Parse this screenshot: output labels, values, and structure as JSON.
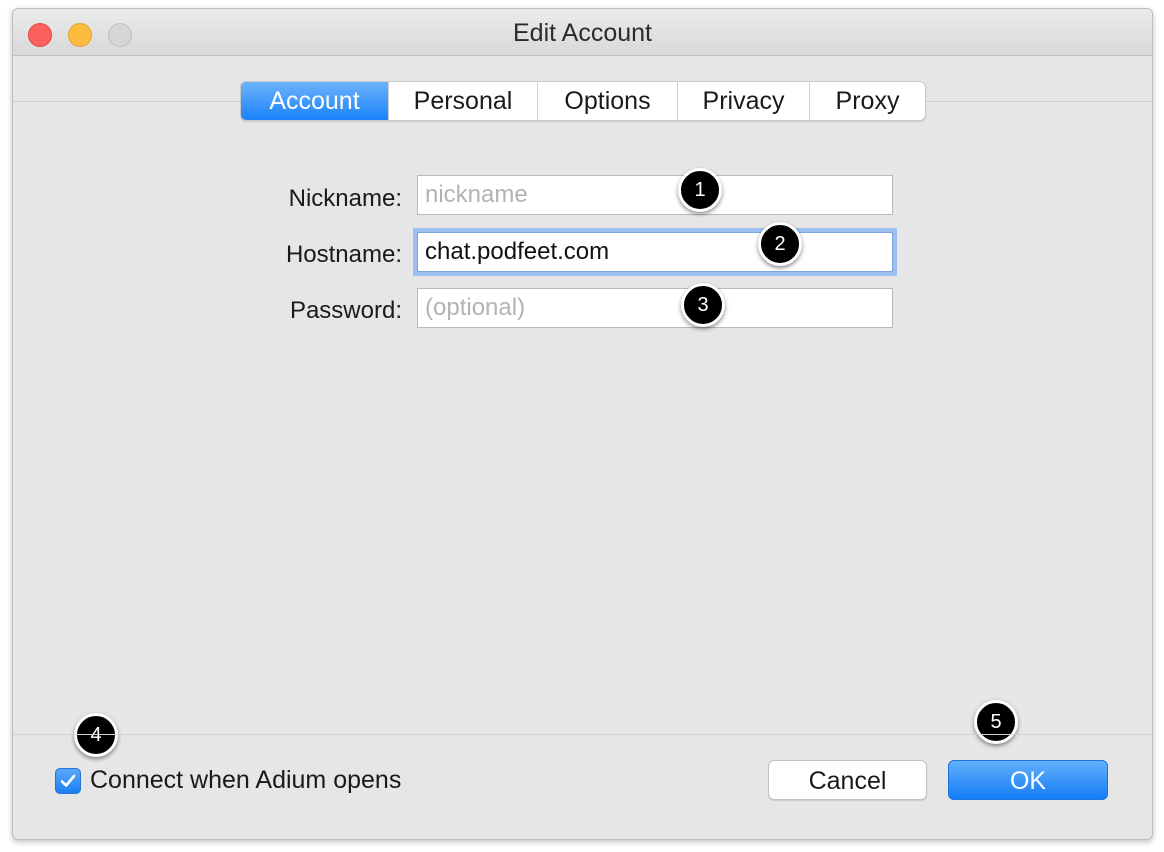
{
  "window": {
    "title": "Edit Account",
    "traffic_lights": [
      "close",
      "minimize",
      "zoom"
    ]
  },
  "tabs": [
    {
      "label": "Account",
      "active": true
    },
    {
      "label": "Personal",
      "active": false
    },
    {
      "label": "Options",
      "active": false
    },
    {
      "label": "Privacy",
      "active": false
    },
    {
      "label": "Proxy",
      "active": false
    }
  ],
  "form": {
    "nickname": {
      "label": "Nickname:",
      "value": "",
      "placeholder": "nickname"
    },
    "hostname": {
      "label": "Hostname:",
      "value": "chat.podfeet.com",
      "placeholder": ""
    },
    "password": {
      "label": "Password:",
      "value": "",
      "placeholder": "(optional)"
    }
  },
  "footer": {
    "connect_checkbox": {
      "label": "Connect when Adium opens",
      "checked": true
    },
    "cancel_label": "Cancel",
    "ok_label": "OK"
  },
  "annotations": [
    "1",
    "2",
    "3",
    "4",
    "5"
  ],
  "colors": {
    "accent": "#1a82fb",
    "focus_ring": "#9cc0ef",
    "badge": "#000000"
  }
}
